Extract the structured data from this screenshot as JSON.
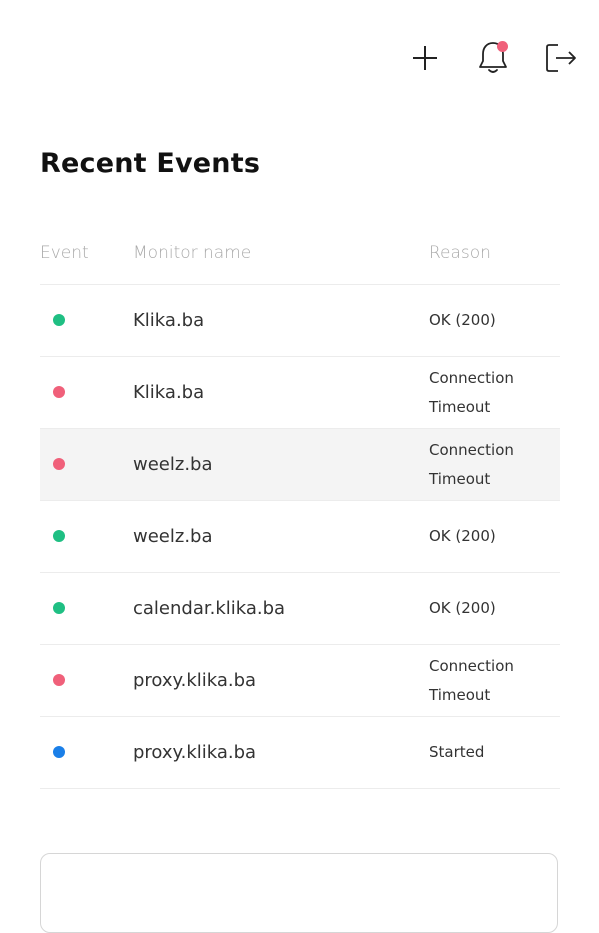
{
  "toolbar": {
    "add_icon": "plus-icon",
    "notification_icon": "bell-icon",
    "logout_icon": "logout-icon",
    "notification_indicator_color": "#f0607a"
  },
  "page": {
    "title": "Recent Events"
  },
  "events": {
    "columns": {
      "event": "Event",
      "monitor_name": "Monitor name",
      "reason": "Reason"
    },
    "rows": [
      {
        "status": "ok",
        "monitor": "Klika.ba",
        "reason": "OK (200)"
      },
      {
        "status": "down",
        "monitor": "Klika.ba",
        "reason": "Connection Timeout"
      },
      {
        "status": "down",
        "monitor": "weelz.ba",
        "reason": "Connection Timeout"
      },
      {
        "status": "ok",
        "monitor": "weelz.ba",
        "reason": "OK (200)"
      },
      {
        "status": "ok",
        "monitor": "calendar.klika.ba",
        "reason": "OK (200)"
      },
      {
        "status": "down",
        "monitor": "proxy.klika.ba",
        "reason": "Connection Timeout"
      },
      {
        "status": "started",
        "monitor": "proxy.klika.ba",
        "reason": "Started"
      }
    ]
  },
  "colors": {
    "ok": "#1fbf83",
    "down": "#f0607a",
    "started": "#1a7fe8",
    "row_highlight": "#f4f4f4"
  }
}
